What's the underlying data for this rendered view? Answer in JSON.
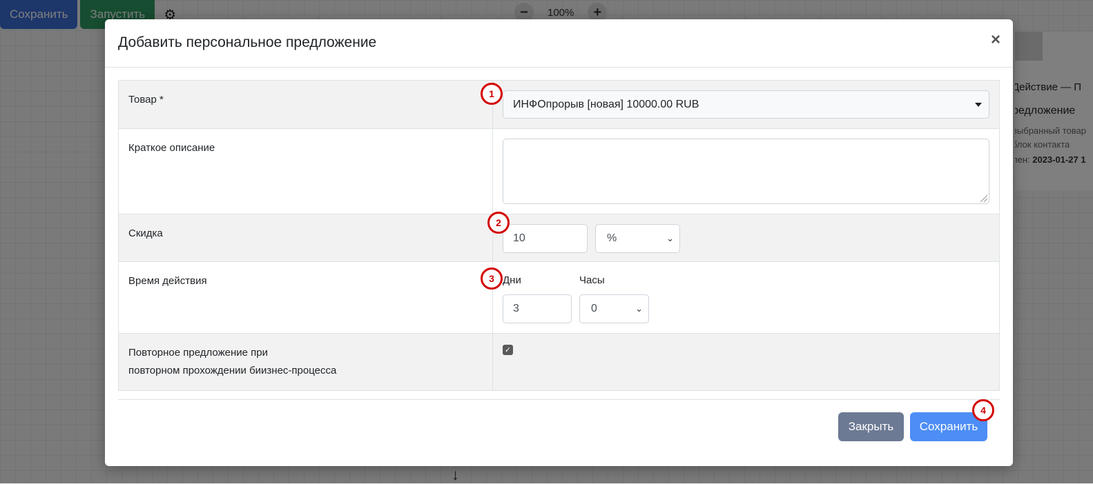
{
  "background": {
    "toolbar": {
      "save_label": "Сохранить",
      "run_label": "Запустить",
      "zoom_minus": "−",
      "zoom_level": "100%",
      "zoom_plus": "+"
    },
    "side_panel": {
      "title": "Действие — П",
      "subtitle": "редложение",
      "desc_line1": "выбранный товар",
      "desc_line2": "блок контакта",
      "added_prefix": "лен:",
      "added_value": "2023-01-27 1"
    }
  },
  "modal": {
    "title": "Добавить персональное предложение",
    "close_symbol": "×",
    "rows": {
      "product": {
        "label": "Товар *",
        "value": "ИНФОпрорыв [новая] 10000.00 RUB"
      },
      "short_description": {
        "label": "Краткое описание",
        "value": ""
      },
      "discount": {
        "label": "Скидка",
        "value": "10",
        "unit": "%"
      },
      "validity": {
        "label": "Время действия",
        "days_label": "Дни",
        "hours_label": "Часы",
        "days_value": "3",
        "hours_value": "0"
      },
      "repeat": {
        "label_line1": "Повторное предложение при",
        "label_line2": "повторном прохождении биизнес-процесса",
        "checked": true
      }
    },
    "footer": {
      "close_label": "Закрыть",
      "save_label": "Сохранить"
    }
  },
  "markers": [
    "1",
    "2",
    "3",
    "4"
  ],
  "colors": {
    "marker": "#d40000",
    "save_button": "#4d8df6",
    "close_button": "#6c7a93"
  }
}
